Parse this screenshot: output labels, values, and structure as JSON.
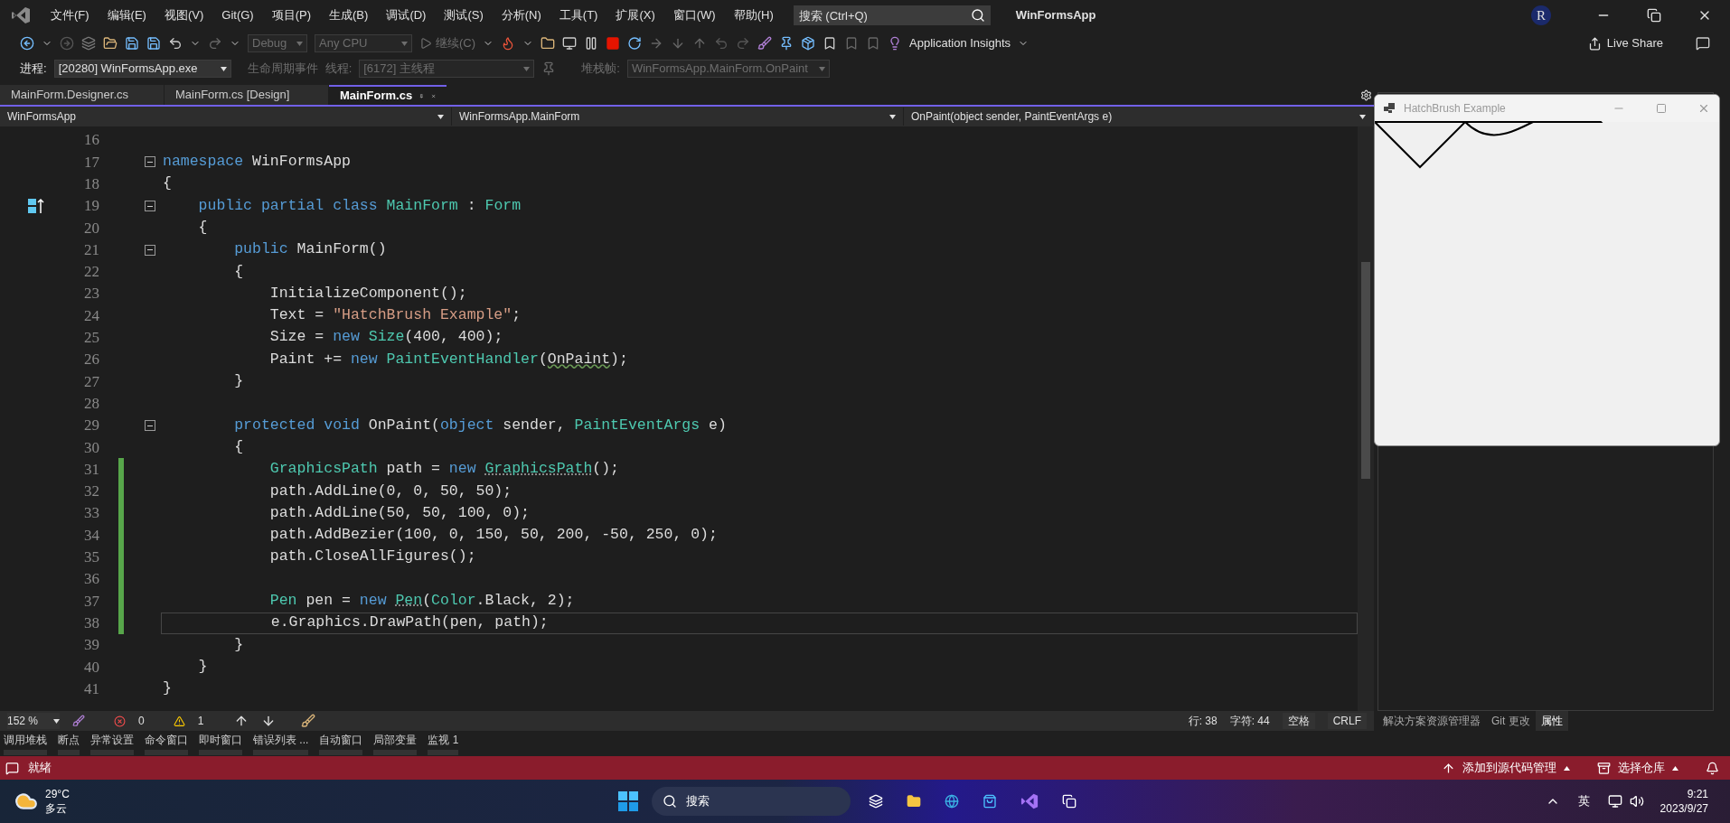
{
  "menu": [
    "文件(F)",
    "编辑(E)",
    "视图(V)",
    "Git(G)",
    "项目(P)",
    "生成(B)",
    "调试(D)",
    "测试(S)",
    "分析(N)",
    "工具(T)",
    "扩展(X)",
    "窗口(W)",
    "帮助(H)"
  ],
  "search": {
    "placeholder": "搜索 (Ctrl+Q)"
  },
  "window_title": "WinFormsApp",
  "avatar": "R",
  "toolbar": {
    "combos": [
      {
        "text": "Debug",
        "disabled": true
      },
      {
        "text": "Any CPU",
        "disabled": true
      }
    ],
    "continue": {
      "text": "继续(C)",
      "disabled": true
    },
    "insights": "Application Insights",
    "live_share": "Live Share"
  },
  "debug_bar": {
    "process_label": "进程:",
    "process": "[20280] WinFormsApp.exe",
    "lifecycle": "生命周期事件",
    "thread_label": "线程:",
    "thread": "[6172] 主线程",
    "stack_label": "堆栈帧:",
    "stack": "WinFormsApp.MainForm.OnPaint"
  },
  "tabs": [
    {
      "label": "MainForm.Designer.cs",
      "selected": false
    },
    {
      "label": "MainForm.cs [Design]",
      "selected": false
    },
    {
      "label": "MainForm.cs",
      "selected": true
    }
  ],
  "nav": [
    "WinFormsApp",
    "WinFormsApp.MainForm",
    "OnPaint(object sender, PaintEventArgs e)"
  ],
  "lines": [
    {
      "n": "16"
    },
    {
      "n": "17",
      "fold": true,
      "segments": [
        {
          "kind": "kw",
          "text": "namespace"
        },
        {
          "kind": "plain",
          "text": " WinFormsApp"
        }
      ]
    },
    {
      "n": "18",
      "segments": [
        {
          "kind": "plain",
          "text": "{"
        }
      ]
    },
    {
      "n": "19",
      "fold": true,
      "margin_icon": true,
      "segments": [
        {
          "kind": "kw",
          "text": "    public partial class"
        },
        {
          "kind": "type",
          "text": " MainForm"
        },
        {
          "kind": "plain",
          "text": " : "
        },
        {
          "kind": "type",
          "text": "Form"
        }
      ]
    },
    {
      "n": "20",
      "segments": [
        {
          "kind": "plain",
          "text": "    {"
        }
      ]
    },
    {
      "n": "21",
      "fold": true,
      "segments": [
        {
          "kind": "kw",
          "text": "        public"
        },
        {
          "kind": "plain",
          "text": " MainForm()"
        }
      ]
    },
    {
      "n": "22",
      "segments": [
        {
          "kind": "plain",
          "text": "        {"
        }
      ]
    },
    {
      "n": "23",
      "segments": [
        {
          "kind": "plain",
          "text": "            InitializeComponent();"
        }
      ]
    },
    {
      "n": "24",
      "segments": [
        {
          "kind": "plain",
          "text": "            Text = "
        },
        {
          "kind": "str",
          "text": "\"HatchBrush Example\""
        },
        {
          "kind": "plain",
          "text": ";"
        }
      ]
    },
    {
      "n": "25",
      "segments": [
        {
          "kind": "plain",
          "text": "            Size = "
        },
        {
          "kind": "kw",
          "text": "new"
        },
        {
          "kind": "type",
          "text": " Size"
        },
        {
          "kind": "plain",
          "text": "(400, 400);"
        }
      ]
    },
    {
      "n": "26",
      "segments": [
        {
          "kind": "plain",
          "text": "            Paint += "
        },
        {
          "kind": "kw",
          "text": "new"
        },
        {
          "kind": "type",
          "text": " PaintEventHandler"
        },
        {
          "kind": "plain",
          "text": "("
        },
        {
          "kind": "plain",
          "text": "OnPaint",
          "squiggle": true
        },
        {
          "kind": "plain",
          "text": ");"
        }
      ]
    },
    {
      "n": "27",
      "segments": [
        {
          "kind": "plain",
          "text": "        }"
        }
      ]
    },
    {
      "n": "28"
    },
    {
      "n": "29",
      "fold": true,
      "segments": [
        {
          "kind": "kw",
          "text": "        protected void"
        },
        {
          "kind": "plain",
          "text": " OnPaint("
        },
        {
          "kind": "kw",
          "text": "object"
        },
        {
          "kind": "plain",
          "text": " sender, "
        },
        {
          "kind": "type",
          "text": "PaintEventArgs"
        },
        {
          "kind": "plain",
          "text": " e)"
        }
      ]
    },
    {
      "n": "30",
      "segments": [
        {
          "kind": "plain",
          "text": "        {"
        }
      ]
    },
    {
      "n": "31",
      "changed": true,
      "segments": [
        {
          "kind": "type",
          "text": "            GraphicsPath"
        },
        {
          "kind": "plain",
          "text": " path = "
        },
        {
          "kind": "kw",
          "text": "new "
        },
        {
          "kind": "type",
          "text": "GraphicsPath",
          "dotted": true
        },
        {
          "kind": "plain",
          "text": "();"
        }
      ]
    },
    {
      "n": "32",
      "changed": true,
      "segments": [
        {
          "kind": "plain",
          "text": "            path.AddLine(0, 0, 50, 50);"
        }
      ]
    },
    {
      "n": "33",
      "changed": true,
      "segments": [
        {
          "kind": "plain",
          "text": "            path.AddLine(50, 50, 100, 0);"
        }
      ]
    },
    {
      "n": "34",
      "changed": true,
      "segments": [
        {
          "kind": "plain",
          "text": "            path.AddBezier(100, 0, 150, 50, 200, -50, 250, 0);"
        }
      ]
    },
    {
      "n": "35",
      "changed": true,
      "segments": [
        {
          "kind": "plain",
          "text": "            path.CloseAllFigures();"
        }
      ]
    },
    {
      "n": "36",
      "changed": true
    },
    {
      "n": "37",
      "changed": true,
      "segments": [
        {
          "kind": "type",
          "text": "            Pen"
        },
        {
          "kind": "plain",
          "text": " pen = "
        },
        {
          "kind": "kw",
          "text": "new "
        },
        {
          "kind": "type",
          "text": "Pen",
          "dotted": true
        },
        {
          "kind": "plain",
          "text": "("
        },
        {
          "kind": "type",
          "text": "Color"
        },
        {
          "kind": "plain",
          "text": ".Black, 2);"
        }
      ]
    },
    {
      "n": "38",
      "changed": true,
      "current": true,
      "segments": [
        {
          "kind": "plain",
          "text": "            e.Graphics.DrawPath(pen, path);"
        }
      ]
    },
    {
      "n": "39",
      "segments": [
        {
          "kind": "plain",
          "text": "        }"
        }
      ]
    },
    {
      "n": "40",
      "segments": [
        {
          "kind": "plain",
          "text": "    }"
        }
      ]
    },
    {
      "n": "41",
      "segments": [
        {
          "kind": "plain",
          "text": "}"
        }
      ]
    }
  ],
  "editor_status": {
    "zoom": "152 %",
    "errors": "0",
    "warnings": "1",
    "line": "行: 38",
    "char": "字符: 44",
    "spaces": "空格",
    "eol": "CRLF"
  },
  "tool_tabs": [
    "调用堆栈",
    "断点",
    "异常设置",
    "命令窗口",
    "即时窗口",
    "错误列表 ...",
    "自动窗口",
    "局部变量",
    "监视 1"
  ],
  "right_tabs": [
    {
      "label": "解决方案资源管理器",
      "selected": false
    },
    {
      "label": "Git 更改",
      "selected": false
    },
    {
      "label": "属性",
      "selected": true
    }
  ],
  "status_bar": {
    "ready": "就绪",
    "source_control": "添加到源代码管理",
    "repo": "选择仓库"
  },
  "form_window": {
    "title": "HatchBrush Example"
  },
  "taskbar": {
    "temp": "29°C",
    "weather": "多云",
    "search": "搜索",
    "ime": "英",
    "time": "9:21",
    "date": "2023/9/27"
  }
}
